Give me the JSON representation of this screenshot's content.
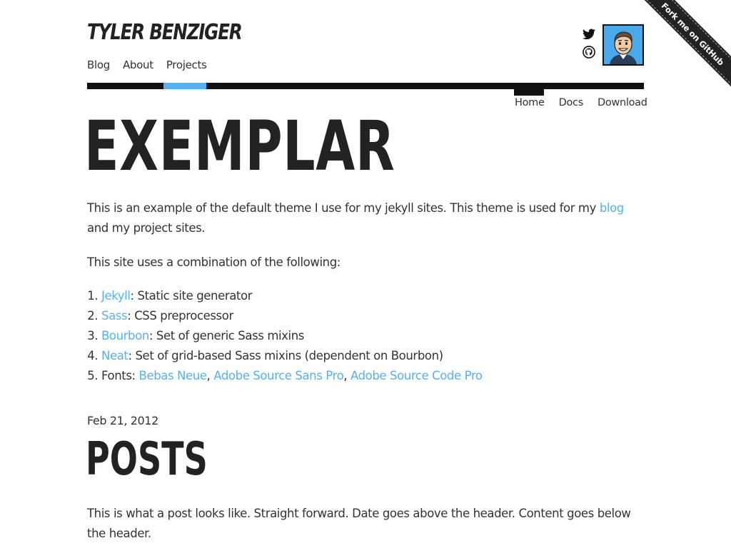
{
  "header": {
    "site_title": "Tyler Benziger",
    "nav": [
      {
        "label": "Blog"
      },
      {
        "label": "About"
      },
      {
        "label": "Projects"
      }
    ],
    "social": [
      {
        "icon": "twitter-icon"
      },
      {
        "icon": "github-icon"
      }
    ],
    "avatar_bg": "#4aa9ea"
  },
  "ribbon": {
    "label": "Fork me on GitHub"
  },
  "project_nav": [
    {
      "label": "Home"
    },
    {
      "label": "Docs"
    },
    {
      "label": "Download"
    }
  ],
  "main": {
    "title": "EXEMPLAR",
    "intro_before_link": "This is an example of the default theme I use for my jekyll sites. This theme is used for my ",
    "intro_link": "blog",
    "intro_after_link": " and my project sites.",
    "uses_intro": "This site uses a combination of the following:",
    "tools": [
      {
        "link": "Jekyll",
        "desc": ": Static site generator"
      },
      {
        "link": "Sass",
        "desc": ": CSS preprocessor"
      },
      {
        "link": "Bourbon",
        "desc": ": Set of generic Sass mixins"
      },
      {
        "link": "Neat",
        "desc": ": Set of grid-based Sass mixins (dependent on Bourbon)"
      }
    ],
    "fonts_label": "Fonts: ",
    "fonts": [
      "Bebas Neue",
      "Adobe Source Sans Pro",
      "Adobe Source Code Pro"
    ],
    "font_separator": ", "
  },
  "post": {
    "date": "Feb 21, 2012",
    "title": "POSTS",
    "body": "This is what a post looks like. Straight forward. Date goes above the header. Content goes below the header."
  },
  "colors": {
    "accent": "#5aaff0",
    "text": "#333333",
    "heading": "#222222",
    "bar": "#111111"
  }
}
